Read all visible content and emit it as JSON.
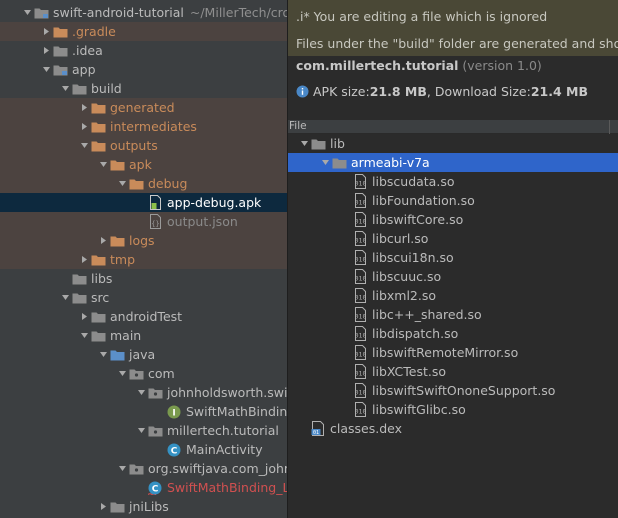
{
  "colors": {
    "folder": "#8c8c8c",
    "folder_excluded": "#c98b5a",
    "folder_source": "#5b8fc9",
    "selection_tree": "#0d293e",
    "selection_list": "#2f65ca",
    "warning_banner": "#4a4836"
  },
  "project_tree": {
    "project_name": "swift-android-tutorial",
    "project_path": "~/MillerTech/cro",
    "items": [
      {
        "label": "swift-android-tutorial",
        "icon": "module-folder-icon",
        "arrow": "down",
        "depth": 0,
        "style": "normal"
      },
      {
        "label": ".gradle",
        "icon": "folder-excluded-icon",
        "arrow": "right",
        "depth": 1,
        "style": "orange",
        "excluded": true
      },
      {
        "label": ".idea",
        "icon": "folder-icon",
        "arrow": "right",
        "depth": 1,
        "style": "normal"
      },
      {
        "label": "app",
        "icon": "module-folder-icon",
        "arrow": "down",
        "depth": 1,
        "style": "normal"
      },
      {
        "label": "build",
        "icon": "folder-icon",
        "arrow": "down",
        "depth": 2,
        "style": "normal"
      },
      {
        "label": "generated",
        "icon": "folder-excluded-icon",
        "arrow": "right",
        "depth": 3,
        "style": "orange",
        "excluded": true
      },
      {
        "label": "intermediates",
        "icon": "folder-excluded-icon",
        "arrow": "right",
        "depth": 3,
        "style": "orange",
        "excluded": true
      },
      {
        "label": "outputs",
        "icon": "folder-excluded-icon",
        "arrow": "down",
        "depth": 3,
        "style": "orange",
        "excluded": true
      },
      {
        "label": "apk",
        "icon": "folder-excluded-icon",
        "arrow": "down",
        "depth": 4,
        "style": "orange",
        "excluded": true
      },
      {
        "label": "debug",
        "icon": "folder-excluded-icon",
        "arrow": "down",
        "depth": 5,
        "style": "orange",
        "excluded": true
      },
      {
        "label": "app-debug.apk",
        "icon": "apk-file-icon",
        "arrow": "none",
        "depth": 6,
        "style": "normal",
        "selected": true
      },
      {
        "label": "output.json",
        "icon": "json-file-icon",
        "arrow": "none",
        "depth": 6,
        "style": "gray",
        "excluded": true
      },
      {
        "label": "logs",
        "icon": "folder-excluded-icon",
        "arrow": "right",
        "depth": 4,
        "style": "orange",
        "excluded": true
      },
      {
        "label": "tmp",
        "icon": "folder-excluded-icon",
        "arrow": "right",
        "depth": 3,
        "style": "orange",
        "excluded": true
      },
      {
        "label": "libs",
        "icon": "folder-icon",
        "arrow": "none",
        "depth": 2,
        "style": "normal"
      },
      {
        "label": "src",
        "icon": "folder-icon",
        "arrow": "down",
        "depth": 2,
        "style": "normal"
      },
      {
        "label": "androidTest",
        "icon": "folder-icon",
        "arrow": "right",
        "depth": 3,
        "style": "normal"
      },
      {
        "label": "main",
        "icon": "folder-icon",
        "arrow": "down",
        "depth": 3,
        "style": "normal"
      },
      {
        "label": "java",
        "icon": "source-folder-icon",
        "arrow": "down",
        "depth": 4,
        "style": "normal"
      },
      {
        "label": "com",
        "icon": "package-icon",
        "arrow": "down",
        "depth": 5,
        "style": "normal"
      },
      {
        "label": "johnholdsworth.swif",
        "icon": "package-icon",
        "arrow": "down",
        "depth": 6,
        "style": "normal"
      },
      {
        "label": "SwiftMathBinding",
        "icon": "interface-icon",
        "arrow": "none",
        "depth": 7,
        "style": "normal"
      },
      {
        "label": "millertech.tutorial",
        "icon": "package-icon",
        "arrow": "down",
        "depth": 6,
        "style": "normal"
      },
      {
        "label": "MainActivity",
        "icon": "class-icon",
        "arrow": "none",
        "depth": 7,
        "style": "normal"
      },
      {
        "label": "org.swiftjava.com_john",
        "icon": "package-icon",
        "arrow": "down",
        "depth": 5,
        "style": "normal"
      },
      {
        "label": "SwiftMathBinding_L",
        "icon": "class-error-icon",
        "arrow": "none",
        "depth": 6,
        "style": "red"
      },
      {
        "label": "jniLibs",
        "icon": "folder-icon",
        "arrow": "right",
        "depth": 4,
        "style": "normal"
      }
    ]
  },
  "apk_analyzer": {
    "banner_title": ".i* You are editing a file which is ignored",
    "banner_message": "Files under the \"build\" folder are generated and sho",
    "package_name": "com.millertech.tutorial",
    "version_text": "(version 1.0)",
    "apk_size_label": "APK size: ",
    "apk_size_value": "21.8 MB",
    "download_size_label": ", Download Size: ",
    "download_size_value": "21.4 MB",
    "column_header": "File",
    "files": [
      {
        "label": "lib",
        "icon": "folder-icon",
        "arrow": "down",
        "depth": 0
      },
      {
        "label": "armeabi-v7a",
        "icon": "folder-icon",
        "arrow": "down",
        "depth": 1,
        "selected": true
      },
      {
        "label": "libscudata.so",
        "icon": "binary-file-icon",
        "arrow": "none",
        "depth": 2
      },
      {
        "label": "libFoundation.so",
        "icon": "binary-file-icon",
        "arrow": "none",
        "depth": 2
      },
      {
        "label": "libswiftCore.so",
        "icon": "binary-file-icon",
        "arrow": "none",
        "depth": 2
      },
      {
        "label": "libcurl.so",
        "icon": "binary-file-icon",
        "arrow": "none",
        "depth": 2
      },
      {
        "label": "libscui18n.so",
        "icon": "binary-file-icon",
        "arrow": "none",
        "depth": 2
      },
      {
        "label": "libscuuc.so",
        "icon": "binary-file-icon",
        "arrow": "none",
        "depth": 2
      },
      {
        "label": "libxml2.so",
        "icon": "binary-file-icon",
        "arrow": "none",
        "depth": 2
      },
      {
        "label": "libc++_shared.so",
        "icon": "binary-file-icon",
        "arrow": "none",
        "depth": 2
      },
      {
        "label": "libdispatch.so",
        "icon": "binary-file-icon",
        "arrow": "none",
        "depth": 2
      },
      {
        "label": "libswiftRemoteMirror.so",
        "icon": "binary-file-icon",
        "arrow": "none",
        "depth": 2
      },
      {
        "label": "libXCTest.so",
        "icon": "binary-file-icon",
        "arrow": "none",
        "depth": 2
      },
      {
        "label": "libswiftSwiftOnoneSupport.so",
        "icon": "binary-file-icon",
        "arrow": "none",
        "depth": 2
      },
      {
        "label": "libswiftGlibc.so",
        "icon": "binary-file-icon",
        "arrow": "none",
        "depth": 2
      },
      {
        "label": "classes.dex",
        "icon": "dex-file-icon",
        "arrow": "none",
        "depth": 0
      }
    ]
  }
}
